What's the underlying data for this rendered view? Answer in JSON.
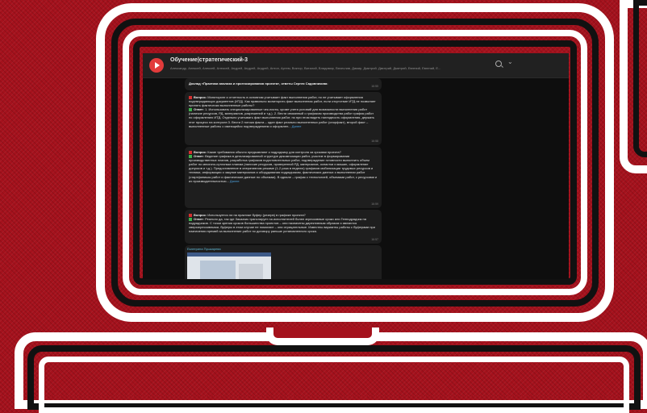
{
  "chat": {
    "title": "Обучение|стратегический-3",
    "members": "Александр, Алексей, Алексей, Алексей, Андрей, Андрей, Андрей, Антон, Артем, Виктор, Виталий, Владимир, Вячеслав, Дамир, Дмитрий, Дмитрий, Дмитрий, Евгений, Евгений, Е..."
  },
  "messages": [
    {
      "text": "Доклад «Практики анализа и прогнозирования проекта», ответы Сергея Садовникова:",
      "time": "16:55"
    },
    {
      "question_label": "Вопрос:",
      "question": "Мониторинг и отчетность в основном учитывает факт выполнения работ, но не учитывает оформления подтверждающих документов (ИТД). Как правильно мониторить факт выполнения работ, если отсутствие ИТД не позволяет принять фактически выполненные работы?",
      "answer_label": "Ответ:",
      "answer": "1. Использовать специализированные чек-листы, кроме учета условий для возможности выполнения работ (наличие ресурсов, РД, материалов, разрешений и т.д.). 2. Вести связанный с графиком производства работ график работ по оформлению ИТД. Отдельно учитывать факт выполнения работ, но при этом видеть наглядность оформления, держать этот процесс на контроле.3. Вести 2 потока факта – один факт реально выполненных работ (опорфакт), второй факт – выполненные работы с имеющейся подтверждением и оформлен...",
      "more": "Далее",
      "time": "16:58"
    },
    {
      "question_label": "Вопрос:",
      "question": "Какие требования обычно предъявляют к подрядчику для контроля за сроками проекта?",
      "answer_label": "Ответ:",
      "answer": "Ведение графика в детализированной структуре декомпозиции работ, участие в формировании производственных планов, разработка графиков подготовительных работ, подтверждение готовности выполнить объем работ по месячно-суточным планам (наличие ресурсов, проверенной РД, материалов, оснастки и машин, оформление допусков и т.д.). Предоставление в оперативном режиме (1-2 раза в неделю) графиков мобилизации трудовых ресурсов и техники, информации о закупке материалов и оборудования подрядчиком, фактических данных о выполнении работ (стартфинишы работ и фактические данные по объемам). В идеале – график с технологией, объемами работ, с ресурсами и их производительностью...",
      "more": "Далее",
      "time": "16:59"
    },
    {
      "question_label": "Вопрос:",
      "question": "Используется ли на практике буфер (резерв) в графике проекта?",
      "answer_label": "Ответ:",
      "answer": "Реально да, так где Заказчик транслирует на исполнителей более агрессивные сроки или Генподрядчик на подрядчиков. С точки зрения сроков большинства проектов – они назначены директивным образом и являются сверхагрессивными, буферы в этом случае не помогают – они отрицательные. Известны варианты работы с буферами при назначении премий за выполнение работ по договору раньше установленного срока.",
      "time": "16:57"
    },
    {
      "sender": "Екатерина Пушкарева"
    }
  ]
}
